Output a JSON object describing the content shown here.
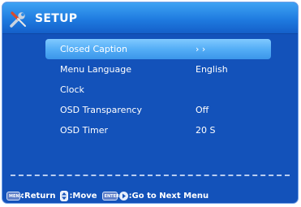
{
  "header": {
    "title": "SETUP",
    "icon": "tools-icon"
  },
  "menu": {
    "items": [
      {
        "label": "Closed Caption",
        "value": "› ›",
        "selected": true
      },
      {
        "label": "Menu Language",
        "value": "English",
        "selected": false
      },
      {
        "label": "Clock",
        "value": "",
        "selected": false
      },
      {
        "label": "OSD Transparency",
        "value": "Off",
        "selected": false
      },
      {
        "label": "OSD Timer",
        "value": "20 S",
        "selected": false
      }
    ]
  },
  "footer": {
    "menu_key": "MENU",
    "return_text": ":Return",
    "move_text": ":Move",
    "enter_key": "ENTER",
    "next_text": ":Go to Next Menu"
  },
  "colors": {
    "background": "#1352ba",
    "header": "#2a8ae8",
    "highlight": "#5fb4f8"
  }
}
